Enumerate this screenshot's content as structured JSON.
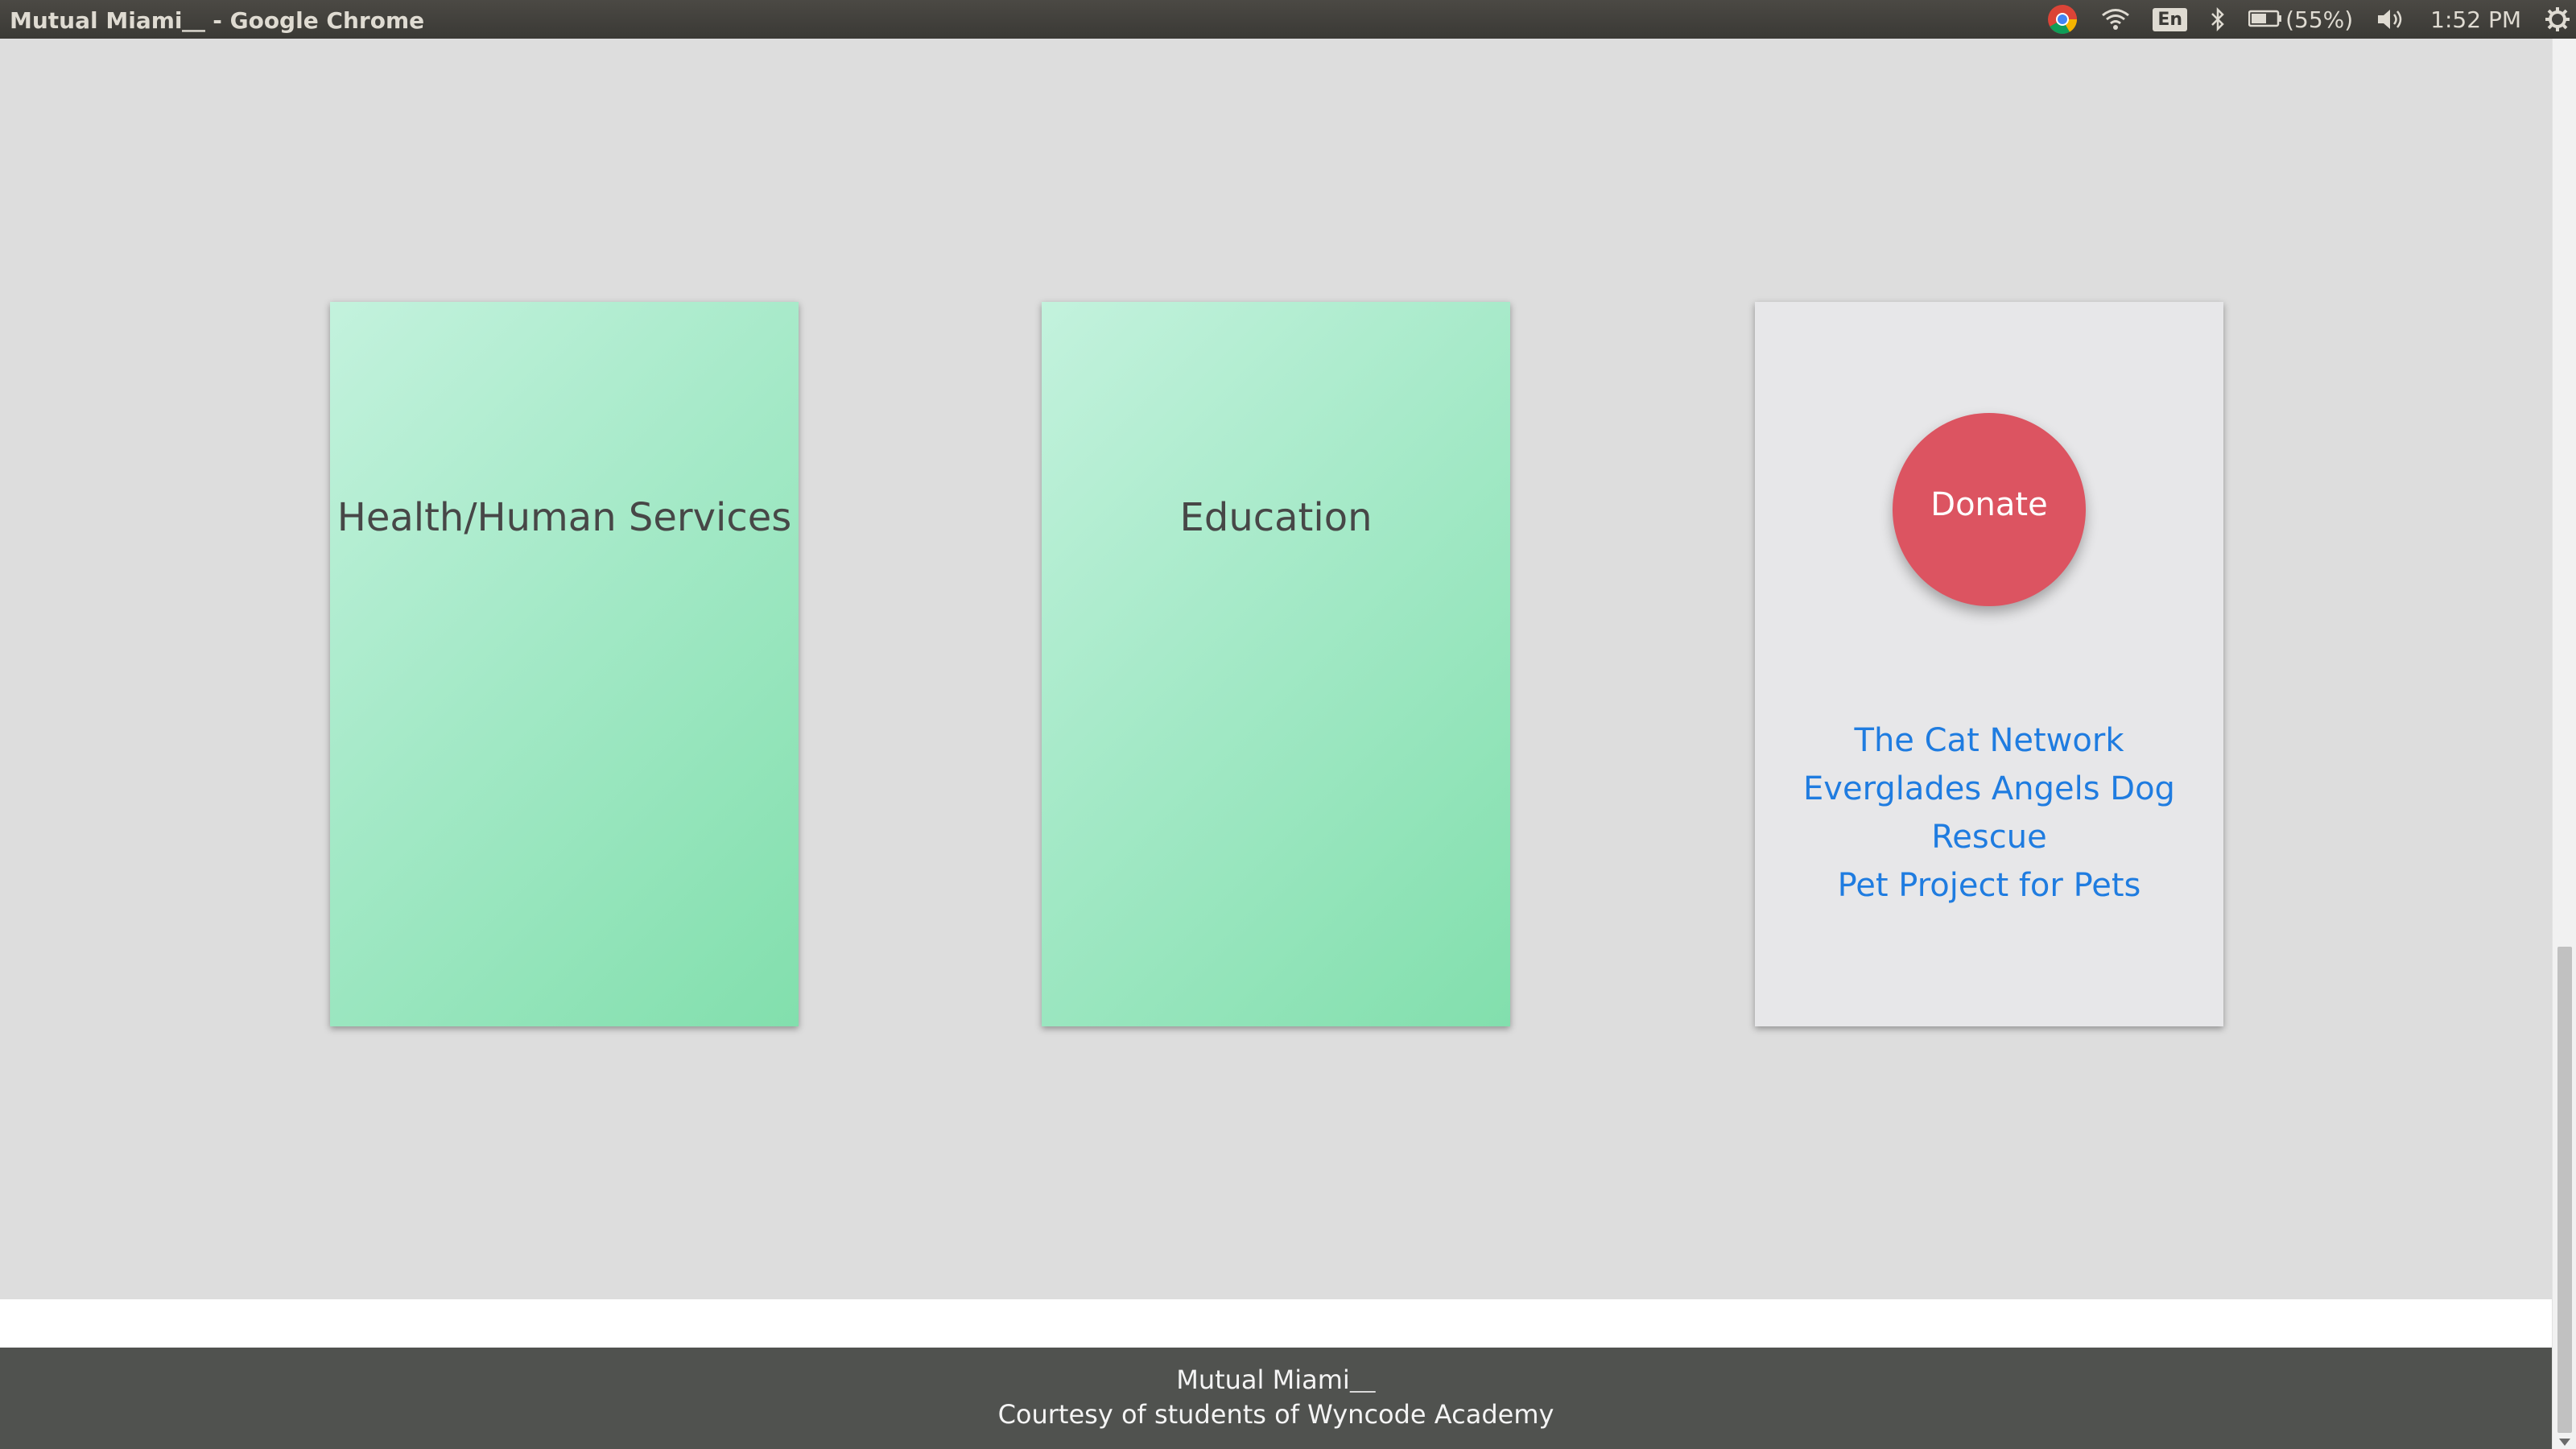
{
  "window": {
    "title": "Mutual Miami⸏ - Google Chrome"
  },
  "tray": {
    "keyboard_layout": "En",
    "battery": "(55%)",
    "clock": "1:52 PM",
    "icons": [
      "chrome-icon",
      "wifi-icon",
      "bluetooth-icon",
      "battery-icon",
      "volume-icon",
      "settings-gear-icon"
    ]
  },
  "cards": {
    "health": {
      "title": "Health/Human Services"
    },
    "education": {
      "title": "Education"
    },
    "donate": {
      "button_label": "Donate",
      "links": [
        "The Cat Network",
        "Everglades Angels Dog Rescue",
        "Pet Project for Pets"
      ]
    }
  },
  "footer": {
    "line1": "Mutual Miami⸏",
    "line2": "Courtesy of students of Wyncode Academy"
  },
  "colors": {
    "donate_button": "#dc5461",
    "link": "#1f7ce0",
    "footer_bg": "#50524f",
    "card_green": "#a4e9c7",
    "page_bg": "#dddddd"
  }
}
